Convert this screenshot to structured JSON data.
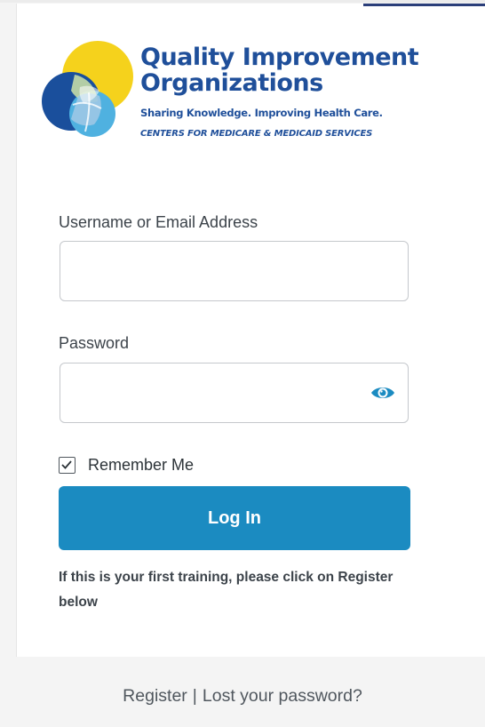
{
  "logo": {
    "title_line1": "Quality Improvement",
    "title_line2": "Organizations",
    "tagline": "Sharing Knowledge. Improving Health Care.",
    "cms": "CENTERS FOR MEDICARE & MEDICAID SERVICES",
    "colors": {
      "yellow": "#f5d21c",
      "navy": "#1a4f9c",
      "sky": "#4fb1e0",
      "text": "#1f4f9a"
    }
  },
  "form": {
    "username_label": "Username or Email Address",
    "username_value": "",
    "password_label": "Password",
    "password_value": "",
    "show_password_icon": "eye-icon",
    "remember_label": "Remember Me",
    "remember_checked": true,
    "login_label": "Log In",
    "button_color": "#1b8bc1"
  },
  "notice": {
    "text": "If this is your first training, please click on Register below"
  },
  "links": {
    "register": "Register",
    "separator": "|",
    "lost_password": "Lost your password?"
  }
}
